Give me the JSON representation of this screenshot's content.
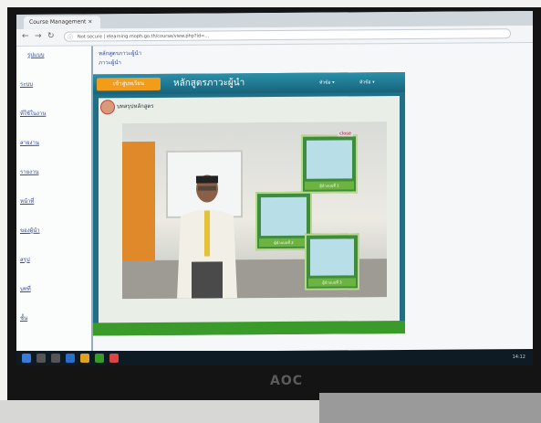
{
  "browser": {
    "tab_title": "Course Management ×",
    "address": "Not secure | elearning.moph.go.th/course/view.php?id=...",
    "lock_icon": "info-icon"
  },
  "sidebar": {
    "links": [
      "รูปแบบ",
      "ระบบ",
      "ที่ใช้ในงาน",
      "สายงาน",
      "รายงาน",
      "หน้าที่",
      "ของผู้นำ",
      "สรุป",
      "บทที่",
      "ชั้น"
    ]
  },
  "breadcrumb": {
    "line1": "หลักสูตรภาวะผู้นำ",
    "line2": "ภาวะผู้นำ"
  },
  "player": {
    "start_label": "เข้าสู่บทเรียน",
    "course_title": "หลักสูตรภาวะผู้นำ",
    "menu_1": "หัวข้อ ▾",
    "menu_2": "หัวข้อ ▾",
    "stage_label": "บทสรุปหลักสูตร",
    "close_label": "close",
    "cards": [
      "ผู้นำแบบที่ 1",
      "ผู้นำแบบที่ 2",
      "ผู้นำแบบที่ 3"
    ]
  },
  "monitor": {
    "brand": "AOC"
  },
  "taskbar": {
    "time": "14:12"
  }
}
